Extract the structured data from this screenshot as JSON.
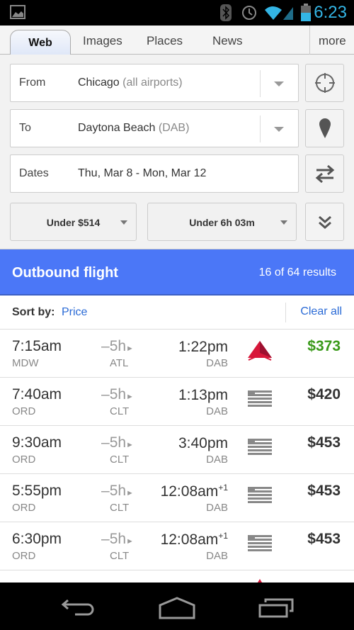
{
  "status_bar": {
    "time": "6:23",
    "icons": [
      "image-icon",
      "bluetooth-icon",
      "alarm-icon",
      "wifi-icon",
      "signal-icon",
      "battery-icon"
    ]
  },
  "tabs": [
    {
      "label": "Web",
      "active": true
    },
    {
      "label": "Images"
    },
    {
      "label": "Places"
    },
    {
      "label": "News"
    },
    {
      "label": "more"
    }
  ],
  "form": {
    "from": {
      "label": "From",
      "value": "Chicago",
      "hint": "(all airports)"
    },
    "to": {
      "label": "To",
      "value": "Daytona Beach",
      "hint": "(DAB)"
    },
    "dates": {
      "label": "Dates",
      "value": "Thu, Mar 8 - Mon, Mar 12"
    },
    "price_filter": "Under $514",
    "duration_filter": "Under 6h 03m"
  },
  "banner": {
    "title": "Outbound flight",
    "results": "16 of 64 results",
    "color": "#4b77f7"
  },
  "sort": {
    "label": "Sort by:",
    "value": "Price",
    "clear": "Clear all"
  },
  "flights": [
    {
      "depart": "7:15am",
      "from": "MDW",
      "duration": "5h",
      "via": "ATL",
      "arrive": "1:22pm",
      "next_day": "",
      "to": "DAB",
      "airline": "delta",
      "price": "$373",
      "best": true
    },
    {
      "depart": "7:40am",
      "from": "ORD",
      "duration": "5h",
      "via": "CLT",
      "arrive": "1:13pm",
      "next_day": "",
      "to": "DAB",
      "airline": "us-airways",
      "price": "$420"
    },
    {
      "depart": "9:30am",
      "from": "ORD",
      "duration": "5h",
      "via": "CLT",
      "arrive": "3:40pm",
      "next_day": "",
      "to": "DAB",
      "airline": "us-airways",
      "price": "$453"
    },
    {
      "depart": "5:55pm",
      "from": "ORD",
      "duration": "5h",
      "via": "CLT",
      "arrive": "12:08am",
      "next_day": "+1",
      "to": "DAB",
      "airline": "us-airways",
      "price": "$453"
    },
    {
      "depart": "6:30pm",
      "from": "ORD",
      "duration": "5h",
      "via": "CLT",
      "arrive": "12:08am",
      "next_day": "+1",
      "to": "DAB",
      "airline": "us-airways",
      "price": "$453"
    }
  ],
  "colors": {
    "best_price": "#3a9a1a",
    "link": "#2a6ad6"
  }
}
